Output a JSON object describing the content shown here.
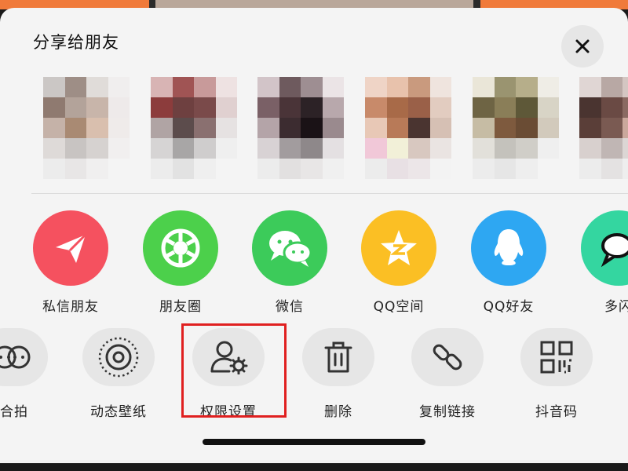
{
  "sheet": {
    "title": "分享给朋友",
    "close_icon": "close-icon"
  },
  "friends": {
    "count_visible": 6,
    "avatars_pixelated": true
  },
  "share_apps": [
    {
      "label": "私信朋友",
      "icon": "send-icon",
      "color": "#f5515f"
    },
    {
      "label": "朋友圈",
      "icon": "moments-aperture-icon",
      "color": "#4cd04b"
    },
    {
      "label": "微信",
      "icon": "wechat-icon",
      "color": "#3ccb5a"
    },
    {
      "label": "QQ空间",
      "icon": "qzone-star-icon",
      "color": "#fbbf24"
    },
    {
      "label": "QQ好友",
      "icon": "qq-penguin-icon",
      "color": "#2ea7f2"
    },
    {
      "label": "多闪",
      "icon": "duoshan-icon",
      "color": "#34d6a0"
    }
  ],
  "tools": [
    {
      "label": "合拍",
      "icon": "duet-icon"
    },
    {
      "label": "动态壁纸",
      "icon": "live-wallpaper-icon"
    },
    {
      "label": "权限设置",
      "icon": "permission-settings-icon"
    },
    {
      "label": "删除",
      "icon": "trash-icon"
    },
    {
      "label": "复制链接",
      "icon": "link-icon"
    },
    {
      "label": "抖音码",
      "icon": "qr-code-icon"
    }
  ],
  "highlighted_item": "权限设置",
  "colors": {
    "sheet_bg": "#f4f4f4",
    "highlight_border": "#e02020",
    "top_accent": "#f07a3a"
  }
}
